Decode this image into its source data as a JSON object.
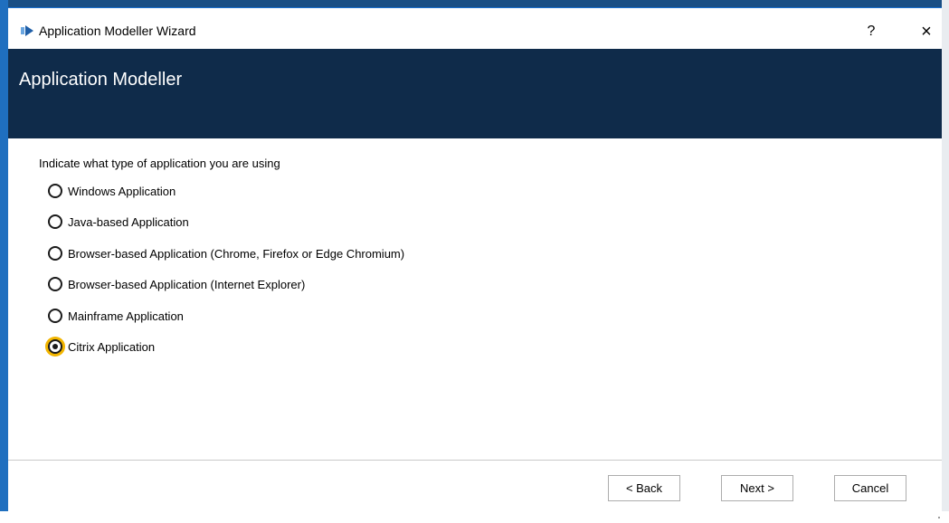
{
  "window": {
    "title": "Application Modeller Wizard",
    "help_label": "?",
    "close_label": "×"
  },
  "banner": {
    "title": "Application Modeller"
  },
  "prompt": "Indicate what type of application you are using",
  "options": [
    {
      "label": "Windows Application",
      "checked": false
    },
    {
      "label": "Java-based Application",
      "checked": false
    },
    {
      "label": "Browser-based Application (Chrome, Firefox or Edge Chromium)",
      "checked": false
    },
    {
      "label": "Browser-based Application (Internet Explorer)",
      "checked": false
    },
    {
      "label": "Mainframe Application",
      "checked": false
    },
    {
      "label": "Citrix Application",
      "checked": true
    }
  ],
  "buttons": {
    "back": "< Back",
    "next": "Next >",
    "cancel": "Cancel"
  },
  "colors": {
    "banner": "#0f2b4a",
    "focus_ring": "#f2b500",
    "accent": "#1f6fbf"
  }
}
